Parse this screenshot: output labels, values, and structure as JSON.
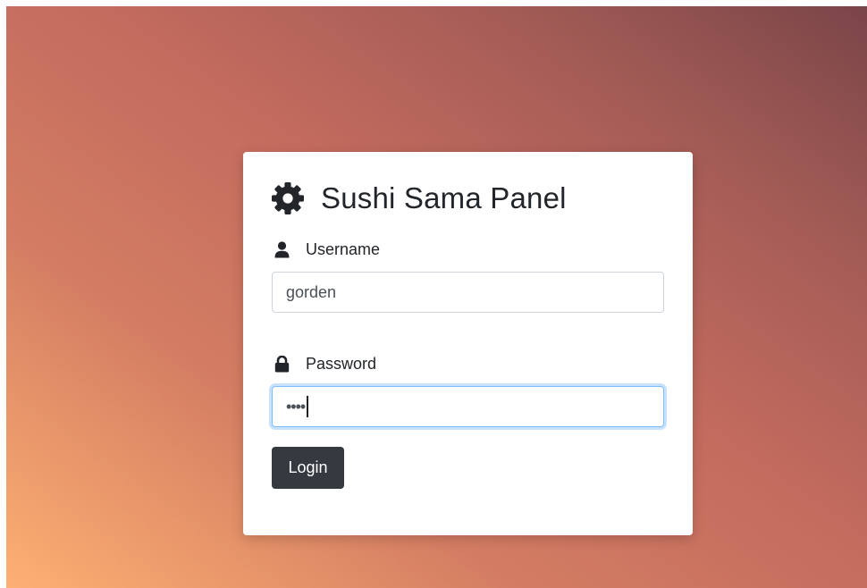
{
  "panel": {
    "title": "Sushi Sama Panel",
    "title_icon": "gear-icon"
  },
  "username": {
    "label": "Username",
    "icon": "user-icon",
    "value": "gorden"
  },
  "password": {
    "label": "Password",
    "icon": "lock-icon",
    "value": "••••",
    "focused": true
  },
  "login_button": {
    "label": "Login"
  },
  "colors": {
    "button_bg": "#343a40",
    "focus_ring": "#80bdff",
    "gradient_top_right": "#7a4548",
    "gradient_bottom_left": "#fdb072"
  }
}
